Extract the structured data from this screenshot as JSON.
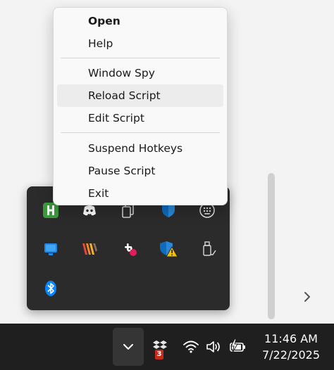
{
  "context_menu": {
    "items": [
      {
        "label": "Open"
      },
      {
        "label": "Help"
      },
      {
        "label": "Window Spy"
      },
      {
        "label": "Reload Script"
      },
      {
        "label": "Edit Script"
      },
      {
        "label": "Suspend Hotkeys"
      },
      {
        "label": "Pause Script"
      },
      {
        "label": "Exit"
      }
    ],
    "default_item": "Open",
    "hovered_item": "Reload Script"
  },
  "tray_flyout": {
    "icons": [
      "autohotkey-icon",
      "discord-icon",
      "copy-icon",
      "defender-shield-icon",
      "keypad-icon",
      "app-window-icon",
      "stripes-app-icon",
      "slack-icon",
      "security-warning-icon",
      "usb-eject-icon",
      "bluetooth-icon"
    ]
  },
  "taskbar": {
    "dropbox_badge": "3",
    "clock": {
      "time": "11:46 AM",
      "date": "7/22/2025"
    }
  },
  "colors": {
    "flyout_bg": "#2b2b2b",
    "taskbar_bg": "#1f1f1f",
    "menu_bg": "#f9f9f9",
    "autohotkey_green": "#3d9b3d",
    "accent_blue": "#0078d4",
    "warning_yellow": "#f2c200"
  }
}
